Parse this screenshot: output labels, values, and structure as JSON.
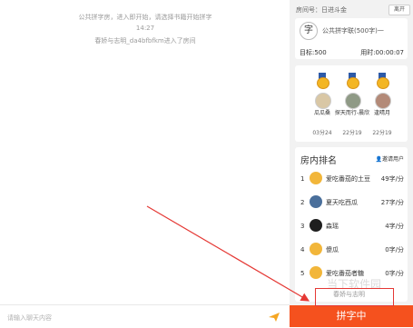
{
  "chat": {
    "messages": [
      "公共拼字房，进入即开始，请选择书籍开始拼字",
      "14:27",
      "春娇与志明_da4bfbfkm进入了房间"
    ],
    "input_placeholder": "请输入聊天内容"
  },
  "submit_label": "拼字中",
  "side": {
    "room_name": "房间号：日进斗金",
    "leave_label": "离开",
    "book": {
      "icon_char": "字",
      "title": "公共拼字联(500字)一",
      "goal": "目标:500",
      "time_used": "用时:00:00:07"
    },
    "podium": [
      {
        "rank_label": "1",
        "name": "瓜瓜桑",
        "time": "03分24"
      },
      {
        "rank_label": "2",
        "name": "探天而行-晨欣",
        "time": "22分19"
      },
      {
        "rank_label": "3",
        "name": "逢晴月",
        "time": "22分19"
      }
    ],
    "ranking": {
      "title": "房内排名",
      "invite_label": "邀请用户",
      "rows": [
        {
          "num": "1",
          "name": "爱吃番茄的土豆",
          "speed": "49字/分"
        },
        {
          "num": "2",
          "name": "夏天吃西瓜",
          "speed": "27字/分"
        },
        {
          "num": "3",
          "name": "森瑶",
          "speed": "4字/分"
        },
        {
          "num": "4",
          "name": "傻瓜",
          "speed": "0字/分"
        },
        {
          "num": "5",
          "name": "爱吃番茄者糖",
          "speed": "0字/分"
        },
        {
          "num": "",
          "name": "春娇与志明",
          "speed": ""
        }
      ]
    }
  },
  "watermark": "当下软件园",
  "colors": {
    "accent": "#f5511e",
    "highlight_box": "#e53935",
    "arrow": "#e53935"
  }
}
